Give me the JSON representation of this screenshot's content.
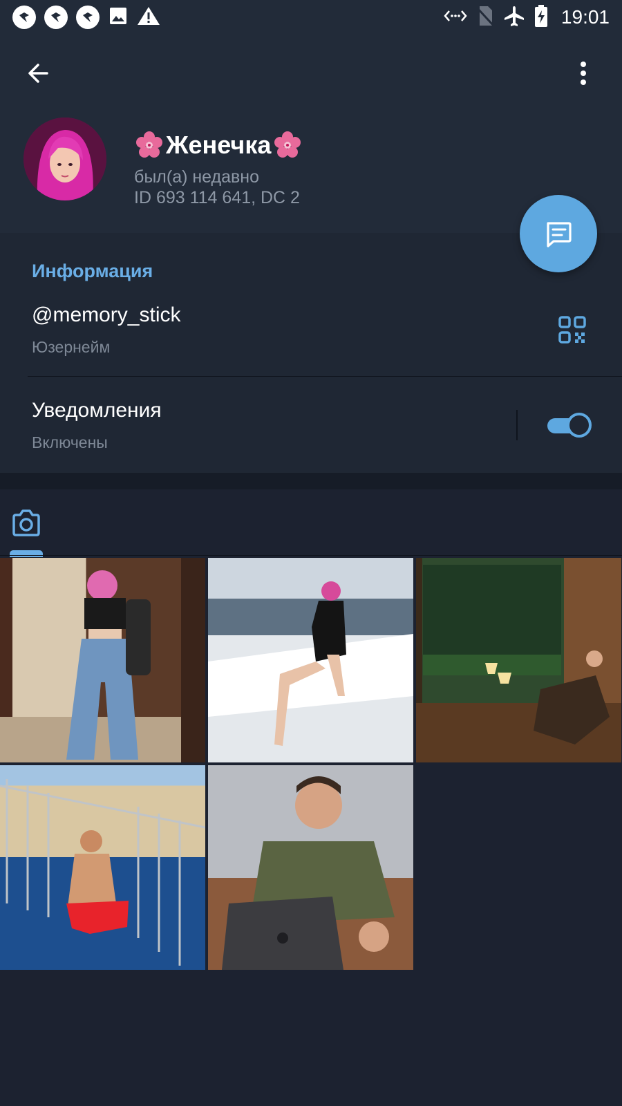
{
  "status_bar": {
    "time": "19:01",
    "left_icons": [
      "app-notification-icon",
      "app-notification-icon",
      "app-notification-icon",
      "image-icon",
      "warning-icon"
    ],
    "right_icons": [
      "data-transfer-icon",
      "no-sim-icon",
      "airplane-mode-icon",
      "battery-charging-icon"
    ]
  },
  "toolbar": {
    "back_icon": "arrow-left-icon",
    "menu_icon": "more-vertical-icon"
  },
  "profile": {
    "name": "Женечка",
    "name_decoration": "cherry-blossom-emoji",
    "last_seen": "был(а) недавно",
    "id_text": "ID 693 114 641, DC 2",
    "avatar": "avatar"
  },
  "fab": {
    "icon": "message-icon"
  },
  "info": {
    "title": "Информация",
    "username": "@memory_stick",
    "username_caption": "Юзернейм",
    "qr_icon": "qr-code-icon",
    "notifications_label": "Уведомления",
    "notifications_caption": "Включены",
    "notifications_enabled": true
  },
  "media": {
    "tab_icon": "camera-icon",
    "accent": "#6aaee6",
    "photos": [
      "photo-1",
      "photo-2",
      "photo-3",
      "photo-4",
      "photo-5"
    ]
  },
  "colors": {
    "background": "#1c2230",
    "header": "#222b39",
    "accent": "#5ea8e0",
    "section_title": "#6aaee6",
    "secondary_text": "#7e8896"
  }
}
